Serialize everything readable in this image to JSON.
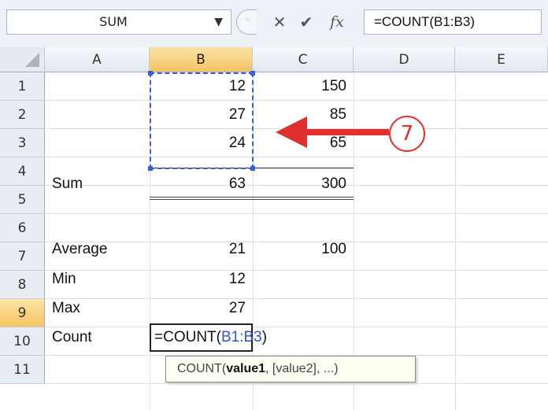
{
  "formula_bar": {
    "name_box": "SUM",
    "formula": "=COUNT(B1:B3)",
    "cancel_icon": "close-icon",
    "enter_icon": "checkmark-icon",
    "insert_function_label": "fx"
  },
  "columns": [
    "A",
    "B",
    "C",
    "D",
    "E"
  ],
  "selected_column": "B",
  "rows": [
    {
      "n": "1",
      "a": "",
      "b": "12",
      "c": "150"
    },
    {
      "n": "2",
      "a": "",
      "b": "27",
      "c": "85"
    },
    {
      "n": "3",
      "a": "",
      "b": "24",
      "c": "65"
    },
    {
      "n": "4",
      "a": "Sum",
      "b": "63",
      "c": "300"
    },
    {
      "n": "5",
      "a": "",
      "b": "",
      "c": ""
    },
    {
      "n": "6",
      "a": "Average",
      "b": "21",
      "c": "100"
    },
    {
      "n": "7",
      "a": "Min",
      "b": "12",
      "c": ""
    },
    {
      "n": "8",
      "a": "Max",
      "b": "27",
      "c": ""
    },
    {
      "n": "9",
      "a": "Count",
      "b": "",
      "c": ""
    },
    {
      "n": "10",
      "a": "",
      "b": "",
      "c": ""
    },
    {
      "n": "11",
      "a": "",
      "b": "",
      "c": ""
    }
  ],
  "active_row": "9",
  "edit": {
    "prefix": "=COUNT(",
    "ref": "B1:B3",
    "suffix": ")"
  },
  "tooltip": {
    "func": "COUNT(",
    "arg1": "value1",
    "rest": ", [value2], ...)"
  },
  "annotation": {
    "step": "7",
    "color": "#e03030"
  },
  "colors": {
    "selection_header": "#f5c462",
    "marquee": "#3a5fd0",
    "reference": "#2f55cc"
  }
}
